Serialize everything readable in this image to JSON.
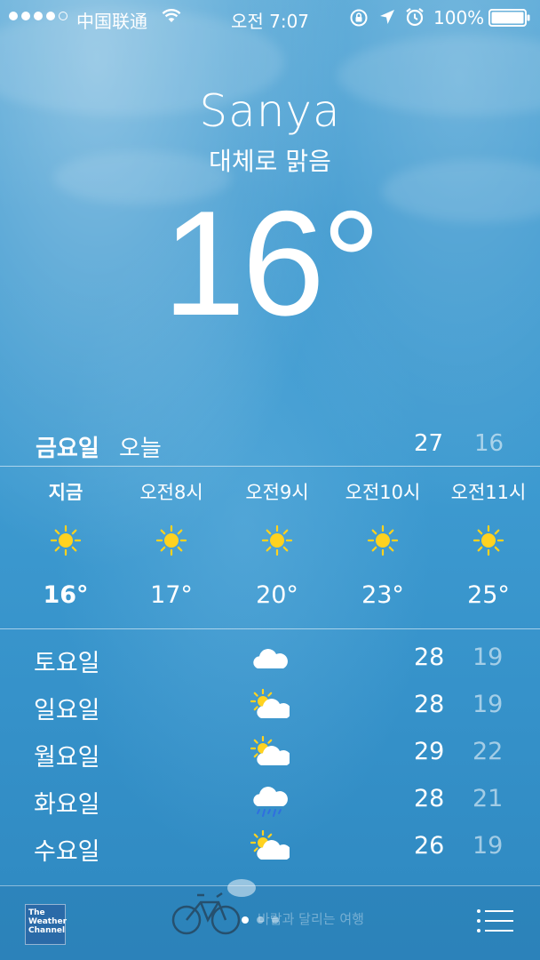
{
  "status_bar": {
    "carrier": "中国联通",
    "time": "오전 7:07",
    "battery": "100%"
  },
  "location": {
    "city": "Sanya",
    "condition": "대체로 맑음",
    "current_temp": "16°"
  },
  "today": {
    "day": "금요일",
    "label": "오늘",
    "high": "27",
    "low": "16"
  },
  "hourly": [
    {
      "label": "지금",
      "icon": "sun-icon",
      "temp": "16°"
    },
    {
      "label": "오전8시",
      "icon": "sun-icon",
      "temp": "17°"
    },
    {
      "label": "오전9시",
      "icon": "sun-icon",
      "temp": "20°"
    },
    {
      "label": "오전10시",
      "icon": "sun-icon",
      "temp": "23°"
    },
    {
      "label": "오전11시",
      "icon": "sun-icon",
      "temp": "25°"
    }
  ],
  "daily": [
    {
      "day": "토요일",
      "icon": "cloud-icon",
      "high": "28",
      "low": "19"
    },
    {
      "day": "일요일",
      "icon": "partly-sunny-icon",
      "high": "28",
      "low": "19"
    },
    {
      "day": "월요일",
      "icon": "partly-sunny-icon",
      "high": "29",
      "low": "22"
    },
    {
      "day": "화요일",
      "icon": "rain-cloud-icon",
      "high": "28",
      "low": "21"
    },
    {
      "day": "수요일",
      "icon": "partly-sunny-icon",
      "high": "26",
      "low": "19"
    }
  ],
  "bottom_bar": {
    "logo_text": "The Weather Channel",
    "watermark": "바람과 달리는 여행"
  },
  "colors": {
    "sun": "#ffd21f",
    "cloud": "#ffffff",
    "rain": "#2f6fe0"
  }
}
